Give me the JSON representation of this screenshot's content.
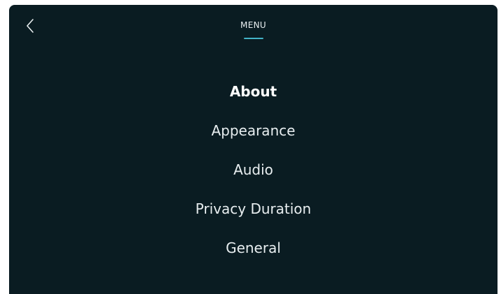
{
  "header": {
    "title": "MENU",
    "back_icon": "chevron-left-icon"
  },
  "menu": {
    "items": [
      {
        "label": "About",
        "active": true
      },
      {
        "label": "Appearance",
        "active": false
      },
      {
        "label": "Audio",
        "active": false
      },
      {
        "label": "Privacy Duration",
        "active": false
      },
      {
        "label": "General",
        "active": false
      }
    ]
  },
  "colors": {
    "background": "#0a1c22",
    "text": "#e8eef0",
    "accent": "#43b3c7"
  }
}
